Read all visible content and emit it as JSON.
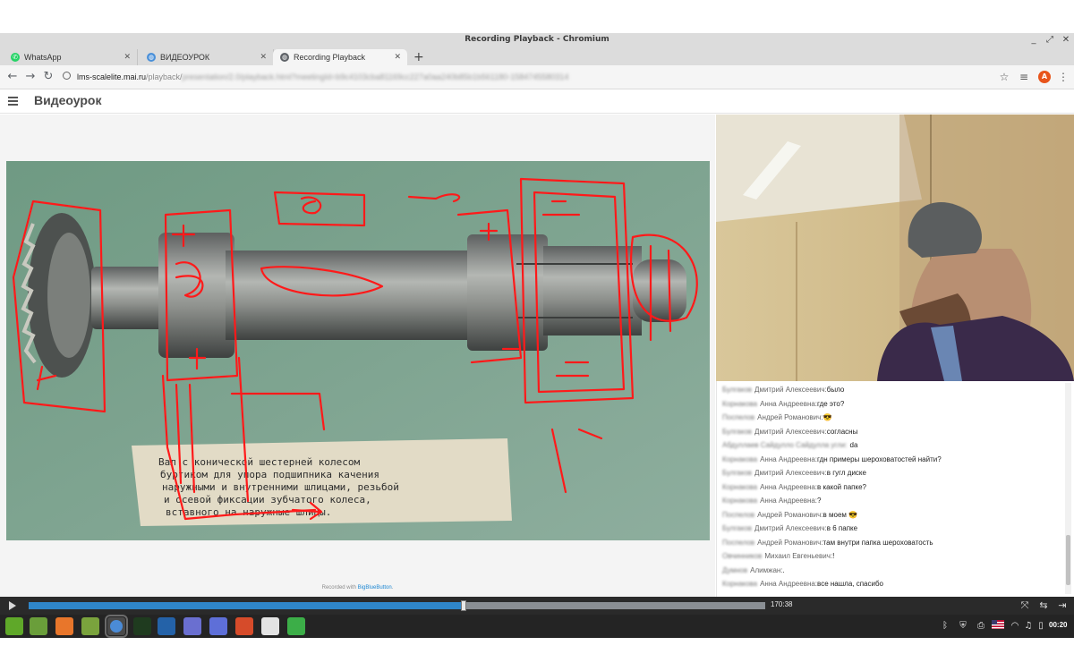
{
  "window": {
    "title": "Recording Playback - Chromium",
    "controls": [
      "_",
      "⤢",
      "✕"
    ]
  },
  "tabs": [
    {
      "label": "WhatsApp",
      "icon": "whatsapp-icon",
      "color": "#25d366"
    },
    {
      "label": "ВИДЕОУРОК",
      "icon": "globe-icon",
      "color": "#4a90d9"
    },
    {
      "label": "Recording Playback",
      "icon": "globe-icon",
      "color": "#5f6368",
      "active": true
    }
  ],
  "newtab_label": "+",
  "toolbar": {
    "back": "←",
    "forward": "→",
    "reload": "↻",
    "url_host": "lms-scalelite.mai.ru",
    "url_path": "/playback/",
    "url_rest": "presentation/2.0/playback.html?meetingId=b9c4103cba81169cc227a0aa240b85b1b561180-1584745580314",
    "star": "☆",
    "avatar_letter": "A"
  },
  "app": {
    "title": "Видеоурок"
  },
  "presentation": {
    "credit_prefix": "Recorded with ",
    "credit_link": "BigBlueButton",
    "credit_suffix": ".",
    "label_text": [
      "Вал с конической шестерней колесом",
      "буртиком для упора подшипника качения",
      "наружными и внутренними шлицами, резьбой",
      "и осевой фиксации зубчатого колеса,",
      "вставного на наружные шлицы."
    ]
  },
  "chat": {
    "messages": [
      {
        "surname": "Булгаков",
        "name": "Дмитрий Алексеевич:",
        "text": "было"
      },
      {
        "surname": "Корнакова",
        "name": "Анна Андреевна:",
        "text": "где это?"
      },
      {
        "surname": "Поспелов",
        "name": "Андрей Романович:",
        "text": "😎"
      },
      {
        "surname": "Булгаков",
        "name": "Дмитрий Алексеевич:",
        "text": "согласны"
      },
      {
        "surname": "Абдуллаев Сайдулло Сайдулла угли:",
        "name": "",
        "text": "da"
      },
      {
        "surname": "Корнакова",
        "name": "Анна Андреевна:",
        "text": "гдн примеры шероховатостей найти?"
      },
      {
        "surname": "Булгаков",
        "name": "Дмитрий Алексеевич:",
        "text": "в гугл диске"
      },
      {
        "surname": "Корнакова",
        "name": "Анна Андреевна:",
        "text": "в какой папке?"
      },
      {
        "surname": "Корнакова",
        "name": "Анна Андреевна:",
        "text": "?"
      },
      {
        "surname": "Поспелов",
        "name": "Андрей Романович:",
        "text": "в моем 😎"
      },
      {
        "surname": "Булгаков",
        "name": "Дмитрий Алексеевич:",
        "text": "в 6 папке"
      },
      {
        "surname": "Поспелов",
        "name": "Андрей Романович:",
        "text": "там внутри папка шероховатость"
      },
      {
        "surname": "Овчинников",
        "name": "Михаил Евгеньевич:",
        "text": "!"
      },
      {
        "surname": "Думнов",
        "name": "Алимжан:",
        "text": "."
      },
      {
        "surname": "Корнакова",
        "name": "Анна Андреевна:",
        "text": "все нашла, спасибо"
      }
    ]
  },
  "playback": {
    "progress": 0.59,
    "timecode": "170:38"
  },
  "taskbar": {
    "clock": "00:20",
    "apps": [
      {
        "name": "mint-menu-icon",
        "color": "#5fa829"
      },
      {
        "name": "files-icon",
        "color": "#6a9e3a"
      },
      {
        "name": "firefox-icon",
        "color": "#e8762b"
      },
      {
        "name": "folder-icon",
        "color": "#7aa33d"
      },
      {
        "name": "chromium-icon",
        "color": "#4b8bd6",
        "active": true
      },
      {
        "name": "terminal-icon",
        "color": "#1f3b1f"
      },
      {
        "name": "vscode-icon",
        "color": "#2462a8"
      },
      {
        "name": "notes-icon",
        "color": "#6a6fd0"
      },
      {
        "name": "screenshot-icon",
        "color": "#5e6fd8"
      },
      {
        "name": "gimp-icon",
        "color": "#d64b2a"
      },
      {
        "name": "inkscape-icon",
        "color": "#e3e3e3"
      },
      {
        "name": "spreadsheet-icon",
        "color": "#3cae48"
      }
    ]
  },
  "colors": {
    "annotation": "#ff1a1a",
    "accent": "#2f86c9",
    "slide_bg": "#7fa38f"
  }
}
